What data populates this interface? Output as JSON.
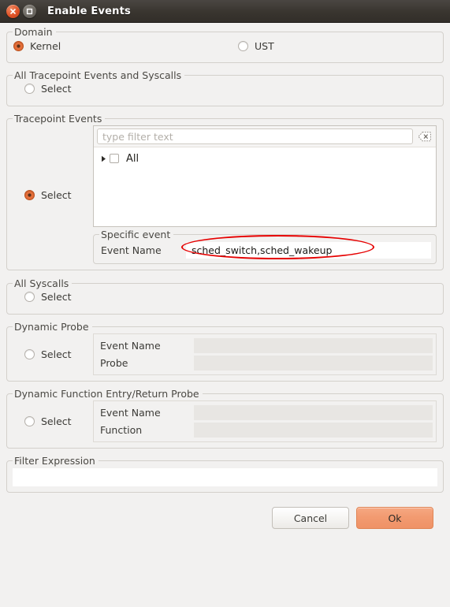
{
  "window": {
    "title": "Enable Events",
    "close_icon": "close-icon",
    "maximize_icon": "maximize-icon"
  },
  "domain": {
    "group_title": "Domain",
    "options": [
      {
        "label": "Kernel",
        "selected": true
      },
      {
        "label": "UST",
        "selected": false
      }
    ]
  },
  "all_tracepoint_events_and_syscalls": {
    "group_title": "All Tracepoint Events and Syscalls",
    "select_label": "Select",
    "selected": false
  },
  "tracepoint_events": {
    "group_title": "Tracepoint Events",
    "select_label": "Select",
    "selected": true,
    "filter": {
      "placeholder": "type filter text",
      "value": "",
      "clear_icon": "clear-text-icon"
    },
    "tree": [
      {
        "label": "All",
        "checked": false,
        "expand_icon": "triangle-right-icon"
      }
    ],
    "specific_event": {
      "group_title": "Specific event",
      "field_label": "Event Name",
      "value": "sched_switch,sched_wakeup",
      "annotated": true
    }
  },
  "all_syscalls": {
    "group_title": "All Syscalls",
    "select_label": "Select",
    "selected": false
  },
  "dynamic_probe": {
    "group_title": "Dynamic Probe",
    "select_label": "Select",
    "selected": false,
    "fields": [
      {
        "label": "Event Name",
        "value": "",
        "disabled": true
      },
      {
        "label": "Probe",
        "value": "",
        "disabled": true
      }
    ]
  },
  "dynamic_function_probe": {
    "group_title": "Dynamic Function Entry/Return Probe",
    "select_label": "Select",
    "selected": false,
    "fields": [
      {
        "label": "Event Name",
        "value": "",
        "disabled": true
      },
      {
        "label": "Function",
        "value": "",
        "disabled": true
      }
    ]
  },
  "filter_expression": {
    "group_title": "Filter Expression",
    "value": ""
  },
  "footer": {
    "cancel_label": "Cancel",
    "ok_label": "Ok"
  },
  "colors": {
    "accent": "#e8733f",
    "ok_button": "#f29b71",
    "annotation": "#e60000",
    "window_bg": "#f2f1f0",
    "titlebar": "#39352f"
  }
}
